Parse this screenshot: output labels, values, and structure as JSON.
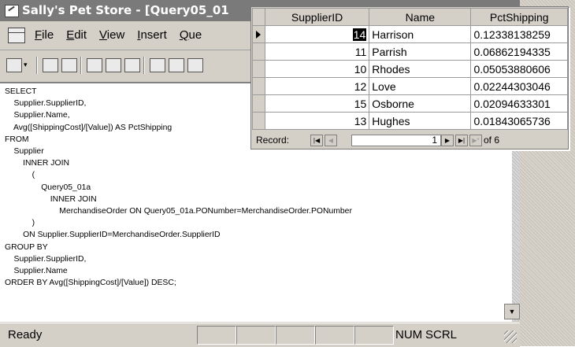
{
  "window": {
    "title": "Sally's Pet Store - [Query05_01"
  },
  "menu": [
    "File",
    "Edit",
    "View",
    "Insert",
    "Que"
  ],
  "sql": {
    "lines": [
      "SELECT",
      "    Supplier.SupplierID,",
      "    Supplier.Name,",
      "    Avg([ShippingCost]/[Value]) AS PctShipping",
      "FROM",
      "    Supplier",
      "        INNER JOIN",
      "            (",
      "                Query05_01a",
      "                    INNER JOIN",
      "                        MerchandiseOrder ON Query05_01a.PONumber=MerchandiseOrder.PONumber",
      "            )",
      "        ON Supplier.SupplierID=MerchandiseOrder.SupplierID",
      "GROUP BY",
      "    Supplier.SupplierID,",
      "    Supplier.Name",
      "ORDER BY Avg([ShippingCost]/[Value]) DESC;"
    ]
  },
  "status": {
    "ready": "Ready",
    "num": "NUM",
    "scrl": "SCRL"
  },
  "datasheet": {
    "columns": [
      "SupplierID",
      "Name",
      "PctShipping"
    ],
    "rows": [
      {
        "id": "14",
        "name": "Harrison",
        "pct": "0.12338138259"
      },
      {
        "id": "11",
        "name": "Parrish",
        "pct": "0.06862194335"
      },
      {
        "id": "10",
        "name": "Rhodes",
        "pct": "0.05053880606"
      },
      {
        "id": "12",
        "name": "Love",
        "pct": "0.02244303046"
      },
      {
        "id": "15",
        "name": "Osborne",
        "pct": "0.02094633301"
      },
      {
        "id": "13",
        "name": "Hughes",
        "pct": "0.01843065736"
      }
    ],
    "nav": {
      "label": "Record:",
      "current": "1",
      "total_text": "of 6"
    }
  }
}
